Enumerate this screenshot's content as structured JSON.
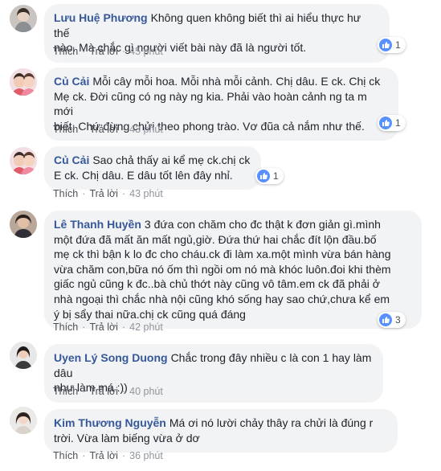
{
  "actions": {
    "like": "Thích",
    "reply": "Trả lời",
    "sep": "·"
  },
  "comments": [
    {
      "author": "Lưu Huệ Phương",
      "lines": [
        "Không quen không biết thì ai hiểu thực hư thế",
        "nào. Mà chắc gì người viết bài này đã là người tốt."
      ],
      "time": "45 phút",
      "likes": "1",
      "avatar": "female-avatar-icon"
    },
    {
      "author": "Củ Cải",
      "lines": [
        "Mỗi cây mỗi hoa. Mỗi nhà mỗi cảnh. Chị dâu. E ck. Chị ck",
        "Mẹ ck. Đời cũng có ng này ng kia. Phải vào hoàn cảnh ng ta m mới",
        "biết. Chứ đừng chửi theo phong trào. Vơ đũa cả nắm như thế."
      ],
      "time": "43 phút",
      "likes": "1",
      "avatar": "child-avatar-icon"
    },
    {
      "author": "Củ Cải",
      "lines": [
        "Sao chả thấy ai kể mẹ ck.chị ck",
        "E ck. Chị dâu. E dâu tốt lên đây nhỉ."
      ],
      "time": "43 phút",
      "likes": "1",
      "avatar": "child-avatar-icon"
    },
    {
      "author": "Lê Thanh Huyền",
      "lines": [
        "3 đứa con chăm cho đc thật k đơn giản gì.mình",
        "một đứa đã mất ăn mất ngủ,giờ. Đứa thứ hai chắc đít lộn đầu.bố",
        "mẹ ck thì bận k lo đc cho cháu.ck đi làm xa.một mình vừa bán hàng",
        "vừa chăm con,bữa nó ốm thì ngồi om nó mà khóc luôn.đoi khi thèm",
        "giấc ngủ cũng k đc..bà chủ thớt này cũng vô tâm.em ck đã phải ở",
        "nhà ngoại thì chắc nhà nội cũng khó sống hay sao chứ,chưa kể em",
        "ý bị sẩy thai nữa.chị ck cũng quá đáng"
      ],
      "time": "42 phút",
      "likes": "3",
      "avatar": "woman-avatar-icon"
    },
    {
      "author": "Uyen Lý Song Duong",
      "lines": [
        "Chắc trong đây nhiều c là con 1 hay làm dâu",
        "như làm má :))"
      ],
      "time": "40 phút",
      "likes": "",
      "avatar": "woman-avatar-icon"
    },
    {
      "author": "Kim Thương Nguyễn",
      "lines": [
        "Má ơi nó lười chảy thây ra chửi là đúng r",
        "trời. Vừa làm biếng vừa ở dơ"
      ],
      "time": "36 phút",
      "likes": "",
      "avatar": "woman-avatar-icon"
    }
  ]
}
